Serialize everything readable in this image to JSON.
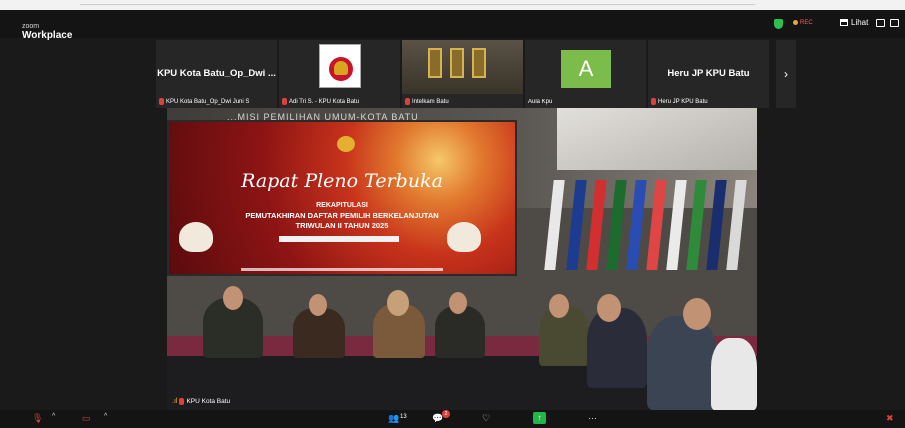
{
  "app": {
    "brand_small": "zoom",
    "brand_big": "Workplace"
  },
  "titlebar": {
    "rec_label": "REC",
    "view_label": "Lihat",
    "accent": "#2fbf4f"
  },
  "participants": [
    {
      "tile_name": "KPU Kota Batu_Op_Dwi ...",
      "caption": "KPU Kota Batu_Op_Dwi Juni S",
      "muted": true
    },
    {
      "tile_name": "",
      "caption": "Adi Tri S. - KPU Kota Batu",
      "muted": true,
      "image": "kpu-logo"
    },
    {
      "tile_name": "",
      "caption": "Intelkam Batu",
      "muted": true,
      "image": "camera-feed"
    },
    {
      "tile_name": "",
      "caption": "Aula Kpu",
      "muted": false,
      "avatar_letter": "A",
      "avatar_color": "#7cbc4a"
    },
    {
      "tile_name": "Heru JP KPU Batu",
      "caption": "Heru JP KPU Batu",
      "muted": true
    }
  ],
  "strip_next_icon": "›",
  "main_video": {
    "speaker_label": "KPU Kota Batu",
    "ceiling_text": "...MISI PEMILIHAN UMUM-KOTA BATU",
    "screen": {
      "script_title": "Rapat Pleno Terbuka",
      "line1": "REKAPITULASI",
      "line2": "PEMUTAKHIRAN DAFTAR PEMILIH BERKELANJUTAN",
      "line3": "TRIWULAN II TAHUN 2025"
    }
  },
  "controls": {
    "participants_count": "13",
    "chat_badge": "2",
    "unmute_caret": "^",
    "video_caret": "^"
  }
}
